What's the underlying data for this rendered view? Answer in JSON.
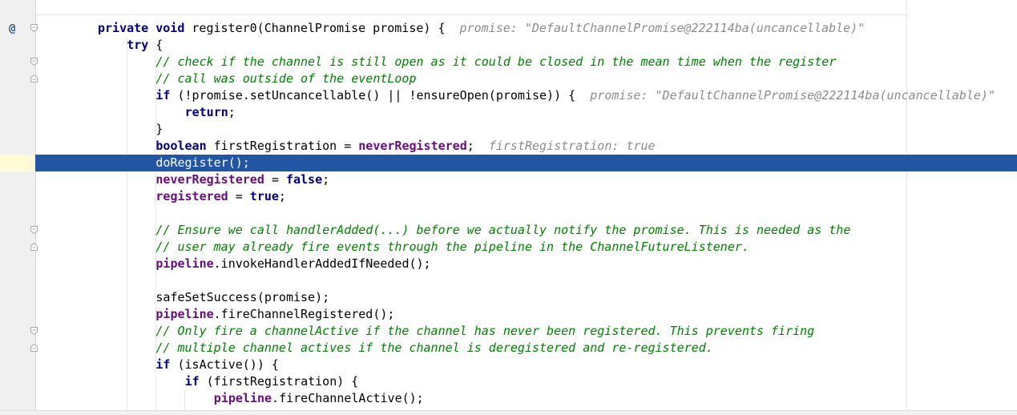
{
  "editor": {
    "lines": [
      {
        "indent": 0,
        "tokens": [
          {
            "t": "private",
            "c": "kw"
          },
          {
            "t": " "
          },
          {
            "t": "void",
            "c": "kw"
          },
          {
            "t": " register0(ChannelPromise promise) {  "
          },
          {
            "t": "promise: \"DefaultChannelPromise@222114ba(uncancellable)\"",
            "c": "hint"
          }
        ],
        "gutter": "override"
      },
      {
        "indent": 1,
        "tokens": [
          {
            "t": "try",
            "c": "kw"
          },
          {
            "t": " {"
          }
        ]
      },
      {
        "indent": 2,
        "tokens": [
          {
            "t": "// check if the channel is still open as it could be closed in the mean time when the register",
            "c": "cmt"
          }
        ],
        "gutter": "fold-start"
      },
      {
        "indent": 2,
        "tokens": [
          {
            "t": "// call was outside of the eventLoop",
            "c": "cmt"
          }
        ],
        "gutter": "fold-end"
      },
      {
        "indent": 2,
        "tokens": [
          {
            "t": "if",
            "c": "kw"
          },
          {
            "t": " (!promise.setUncancellable() || !ensureOpen(promise)) {  "
          },
          {
            "t": "promise: \"DefaultChannelPromise@222114ba(uncancellable)\"",
            "c": "hint"
          }
        ]
      },
      {
        "indent": 3,
        "tokens": [
          {
            "t": "return",
            "c": "kw"
          },
          {
            "t": ";"
          }
        ]
      },
      {
        "indent": 2,
        "tokens": [
          {
            "t": "}"
          }
        ]
      },
      {
        "indent": 2,
        "tokens": [
          {
            "t": "boolean",
            "c": "kw"
          },
          {
            "t": " firstRegistration = "
          },
          {
            "t": "neverRegistered",
            "c": "fld"
          },
          {
            "t": ";  "
          },
          {
            "t": "firstRegistration: true",
            "c": "hint"
          }
        ]
      },
      {
        "indent": 2,
        "current": true,
        "tokens": [
          {
            "t": "doRegister();"
          }
        ]
      },
      {
        "indent": 2,
        "tokens": [
          {
            "t": "neverRegistered",
            "c": "fld"
          },
          {
            "t": " = "
          },
          {
            "t": "false",
            "c": "kw"
          },
          {
            "t": ";"
          }
        ]
      },
      {
        "indent": 2,
        "tokens": [
          {
            "t": "registered",
            "c": "fld"
          },
          {
            "t": " = "
          },
          {
            "t": "true",
            "c": "kw"
          },
          {
            "t": ";"
          }
        ]
      },
      {
        "indent": 2,
        "tokens": []
      },
      {
        "indent": 2,
        "tokens": [
          {
            "t": "// Ensure we call handlerAdded(...) before we actually notify the promise. This is needed as the",
            "c": "cmt"
          }
        ],
        "gutter": "fold-start"
      },
      {
        "indent": 2,
        "tokens": [
          {
            "t": "// user may already fire events through the pipeline in the ChannelFutureListener.",
            "c": "cmt"
          }
        ],
        "gutter": "fold-end"
      },
      {
        "indent": 2,
        "tokens": [
          {
            "t": "pipeline",
            "c": "fld"
          },
          {
            "t": ".invokeHandlerAddedIfNeeded();"
          }
        ]
      },
      {
        "indent": 2,
        "tokens": []
      },
      {
        "indent": 2,
        "tokens": [
          {
            "t": "safeSetSuccess(promise);"
          }
        ]
      },
      {
        "indent": 2,
        "tokens": [
          {
            "t": "pipeline",
            "c": "fld"
          },
          {
            "t": ".fireChannelRegistered();"
          }
        ]
      },
      {
        "indent": 2,
        "tokens": [
          {
            "t": "// Only fire a channelActive if the channel has never been registered. This prevents firing",
            "c": "cmt"
          }
        ],
        "gutter": "fold-start"
      },
      {
        "indent": 2,
        "tokens": [
          {
            "t": "// multiple channel actives if the channel is deregistered and re-registered.",
            "c": "cmt"
          }
        ],
        "gutter": "fold-end"
      },
      {
        "indent": 2,
        "tokens": [
          {
            "t": "if",
            "c": "kw"
          },
          {
            "t": " (isActive()) {"
          }
        ]
      },
      {
        "indent": 3,
        "tokens": [
          {
            "t": "if",
            "c": "kw"
          },
          {
            "t": " (firstRegistration) {"
          }
        ]
      },
      {
        "indent": 4,
        "tokens": [
          {
            "t": "pipeline",
            "c": "fld"
          },
          {
            "t": ".fireChannelActive();"
          }
        ]
      }
    ]
  },
  "gutter_icons": {
    "override": {
      "glyph": "@",
      "icon": "override-method-icon"
    }
  },
  "colors": {
    "keyword": "#000080",
    "field": "#660e7a",
    "comment": "#008000",
    "inlay_hint": "#8c8c8c",
    "current_line": "#2255a4"
  }
}
